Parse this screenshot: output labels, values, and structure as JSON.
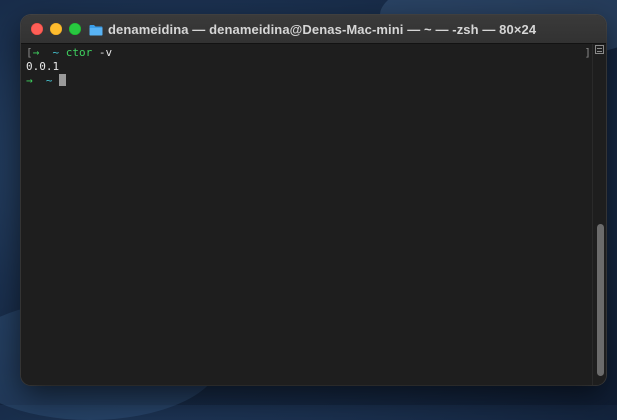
{
  "window": {
    "title": "denameidina — denameidina@Denas-Mac-mini — ~ — -zsh — 80×24",
    "folder_icon": "folder-icon",
    "colors": {
      "background": "#1e1e1e",
      "prompt_arrow": "#3fd15f",
      "cwd": "#47c8d6",
      "command": "#3fd15f",
      "text": "#e8e8e8"
    }
  },
  "terminal": {
    "lines": [
      {
        "bracket": "[",
        "arrow": "→",
        "cwd": "~",
        "command": "ctor",
        "args": " -v"
      },
      {
        "output": "0.0.1"
      },
      {
        "arrow": "→",
        "cwd": "~"
      }
    ],
    "right_bracket": "]"
  }
}
